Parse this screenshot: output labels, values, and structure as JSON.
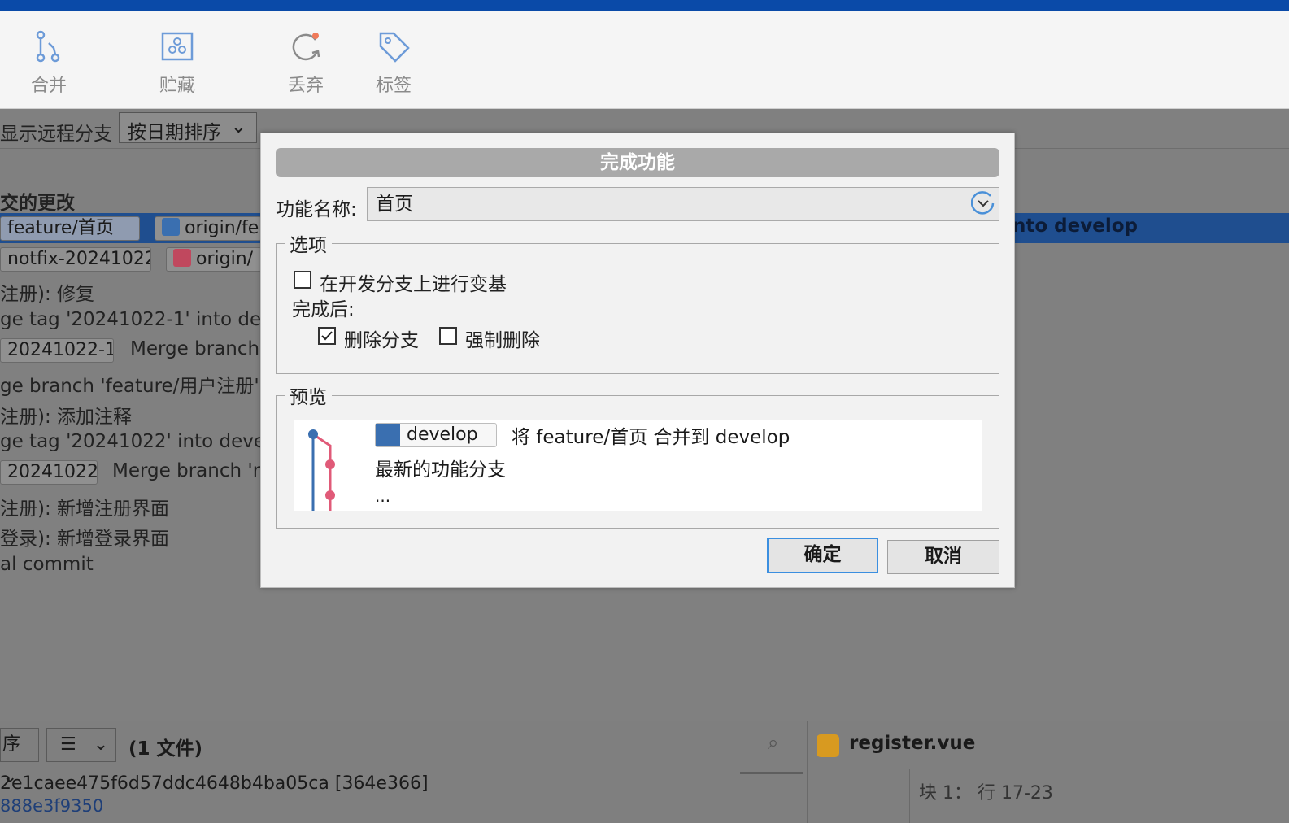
{
  "toolbar": {
    "items": [
      {
        "label": "合并",
        "icon": "merge-icon"
      },
      {
        "label": "贮藏",
        "icon": "stash-icon"
      },
      {
        "label": "丢弃",
        "icon": "discard-icon"
      },
      {
        "label": "标签",
        "icon": "tag-icon"
      }
    ]
  },
  "background": {
    "show_remote_label": "显示远程分支",
    "sort_dropdown": "按日期排序",
    "uncommitted": "交的更改",
    "selected_row_text": "nto develop",
    "refs": {
      "feature_local": "feature/首页",
      "feature_remote": "origin/fe",
      "hotfix_local": "notfix-20241022",
      "hotfix_remote": "origin/",
      "tag1": "20241022-1",
      "tag2": "20241022"
    },
    "commits": [
      "注册): 修复",
      "ge tag '20241022-1' into dev",
      "Merge branch",
      "ge branch 'feature/用户注册'",
      "注册): 添加注释",
      "ge tag '20241022' into devel",
      "Merge branch 'r",
      "注册): 新增注册界面",
      "登录): 新增登录界面",
      "al commit"
    ],
    "bottom": {
      "sort_short": "序",
      "file_count": "(1 文件)",
      "file_name": "register.vue",
      "hash_line": "2e1caee475f6d57ddc4648b4ba05ca [364e366]",
      "hash_link": "888e3f9350",
      "hunk_info": "块 1： 行 17-23"
    }
  },
  "dialog": {
    "title": "完成功能",
    "feature_name_label": "功能名称:",
    "feature_name_value": "首页",
    "options_group": "选项",
    "rebase_option": "在开发分支上进行变基",
    "rebase_checked": false,
    "after_label": "完成后:",
    "delete_branch": "删除分支",
    "delete_branch_checked": true,
    "force_delete": "强制删除",
    "force_delete_checked": false,
    "preview_group": "预览",
    "preview": {
      "branch": "develop",
      "merge_text": "将 feature/首页 合并到 develop",
      "latest_text": "最新的功能分支",
      "ellipsis": "..."
    },
    "ok_button": "确定",
    "cancel_button": "取消"
  },
  "colors": {
    "title_bar": "#0a4aa8",
    "selected_row": "#1f4e8f",
    "accent_blue": "#3a6fb0",
    "graph_pink": "#e05a78"
  }
}
